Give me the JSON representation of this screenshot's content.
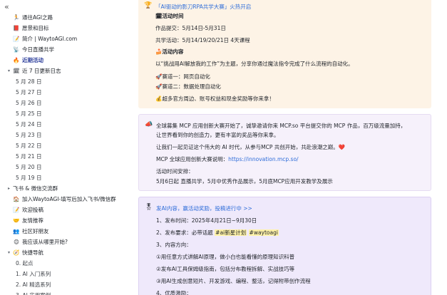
{
  "sidebar": {
    "collapse_icon": "double-chevron-left-icon",
    "items": [
      {
        "icon": "🏃",
        "label": "通往AGI之路",
        "level": 0,
        "chev": ""
      },
      {
        "icon": "📕",
        "label": "愿景和目标",
        "level": 0,
        "chev": ""
      },
      {
        "icon": "📝",
        "label": "简介 | WaytoAGI.com",
        "level": 0,
        "chev": ""
      },
      {
        "icon": "📡",
        "label": "今日直播共学",
        "level": 0,
        "chev": ""
      },
      {
        "icon": "🔥",
        "label": "近期活动",
        "level": 0,
        "chev": "",
        "active": true
      },
      {
        "icon": "🗓",
        "label": "近 7 日更新日志",
        "level": 0,
        "chev": "▾"
      },
      {
        "icon": "",
        "label": "5 月 28 日",
        "level": 1
      },
      {
        "icon": "",
        "label": "5 月 27 日",
        "level": 1
      },
      {
        "icon": "",
        "label": "5 月 26 日",
        "level": 1
      },
      {
        "icon": "",
        "label": "5 月 25 日",
        "level": 1
      },
      {
        "icon": "",
        "label": "5 月 24 日",
        "level": 1
      },
      {
        "icon": "",
        "label": "5 月 23 日",
        "level": 1
      },
      {
        "icon": "",
        "label": "5 月 22 日",
        "level": 1
      },
      {
        "icon": "",
        "label": "5 月 21 日",
        "level": 1
      },
      {
        "icon": "",
        "label": "5 月 20 日",
        "level": 1
      },
      {
        "icon": "",
        "label": "5 月 19 日",
        "level": 1
      },
      {
        "icon": "",
        "label": "飞书 & 微信交流群",
        "level": 0,
        "chev": "▸"
      },
      {
        "icon": "🏠",
        "label": "加入WaytoAGI-填写后加入飞书/微信群",
        "level": 0,
        "chev": ""
      },
      {
        "icon": "📝",
        "label": "欢迎投稿",
        "level": 0,
        "chev": ""
      },
      {
        "icon": "🤝",
        "label": "友情推荐",
        "level": 0,
        "chev": ""
      },
      {
        "icon": "👥",
        "label": "社区好朋友",
        "level": 0,
        "chev": ""
      },
      {
        "icon": "😊",
        "label": "我应该从哪里开始?",
        "level": 0,
        "chev": ""
      },
      {
        "icon": "🧭",
        "label": "快捷导航",
        "level": 0,
        "chev": "▾"
      },
      {
        "icon": "",
        "label": "0. 起点",
        "level": 1
      },
      {
        "icon": "",
        "label": "1. AI 入门系列",
        "level": 1
      },
      {
        "icon": "",
        "label": "2. AI 精选系列",
        "level": 1
      },
      {
        "icon": "",
        "label": "3. AI 实用案例",
        "level": 1
      }
    ]
  },
  "card1": {
    "icon": "🏆",
    "title": "「AI驱动的影刀RPA共学大赛」火热开启",
    "time_heading": "🗓活动时间",
    "submit": "作品提交：5月14日-5月31日",
    "cowork": "共学活动：5月14/19/20/21日 4天课程",
    "content_heading": "🍰活动内容",
    "content": "以“挑战用AI解放我的工作”为主题，分享你通过魔法指令完成了什么流程的自动化。",
    "track1": "🚀赛道一：网页自动化",
    "track2": "🚀赛道二：数据处理自动化",
    "prize": "💰超多官方周边、账号权益和现金奖励等你来拿！"
  },
  "card2": {
    "icon": "📣",
    "p1a": "全球募集 MCP 应用创新大赛开始了，诚挚邀请你来 MCP.so 平台提交你的 MCP 作品，百万级流量加持，",
    "p1b": "让世界看到你的创造力，更有丰富的奖品等你来拿。",
    "p2": "让我们一起见证这个伟大的 AI 时代，从参与MCP 共创开始，共赴浪潮之巅。❤️",
    "p3_prefix": "MCP 全球应用创新大赛说明：",
    "p3_link": "https://innovation.mcp.so/",
    "p4": "活动时间安排：",
    "p5": "5月6日起 直播共学，5月中优秀作品展示，5月底MCP应用开发教学及展示"
  },
  "card3": {
    "icon": "🎖",
    "title": "发AI内容，赢活动奖励，投稿进行中 >>",
    "l1": "1、发布时间：2025年4月21日~9月30日",
    "l2_prefix": "2、发布要求：必带话题",
    "tag1": "#ai新星计划",
    "tag2": "#waytoagi",
    "l3": "3、内容方向：",
    "l4": "①用任意方式讲解AI原理，做小白也能看懂的原理知识科普",
    "l5": "②发布AI工具保姆级指南，包括分布教程拆解、实战技巧等",
    "l6": "③用AI生成创意短片、开发游戏、编程、整活，记得附带创作流程",
    "l7": "4、优质激励："
  }
}
